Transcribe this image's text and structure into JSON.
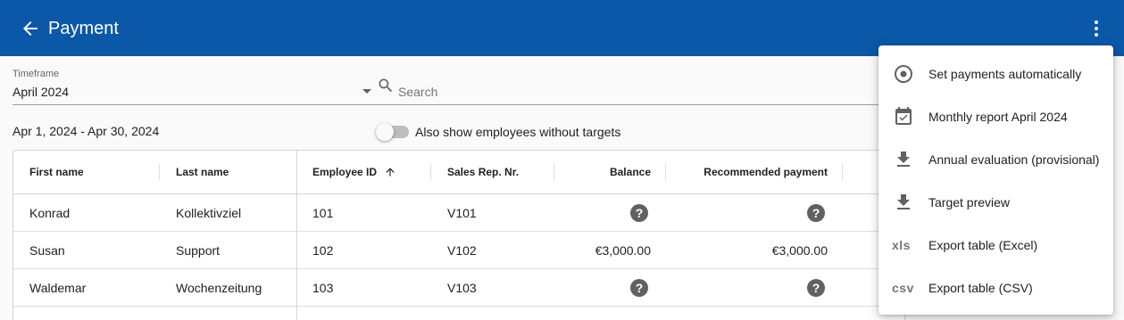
{
  "header": {
    "title": "Payment",
    "back_icon": "arrow-back-icon",
    "more_icon": "more-vert-icon",
    "bg_color": "#0b57a8"
  },
  "filters": {
    "timeframe_label": "Timeframe",
    "timeframe_value": "April 2024",
    "search_placeholder": "Search",
    "date_range": "Apr 1, 2024 - Apr 30, 2024",
    "toggle_label": "Also show employees without targets",
    "toggle_on": false
  },
  "table": {
    "columns": [
      "First name",
      "Last name",
      "Employee ID",
      "Sales Rep. Nr.",
      "Balance",
      "Recommended payment"
    ],
    "sorted_column": "Employee ID",
    "sort_direction": "ascending",
    "rows": [
      {
        "first": "Konrad",
        "last": "Kollektivziel",
        "id": "101",
        "rep": "V101",
        "balance": "?",
        "payment": "?"
      },
      {
        "first": "Susan",
        "last": "Support",
        "id": "102",
        "rep": "V102",
        "balance": "€3,000.00",
        "payment": "€3,000.00"
      },
      {
        "first": "Waldemar",
        "last": "Wochenzeitung",
        "id": "103",
        "rep": "V103",
        "balance": "?",
        "payment": "?"
      }
    ]
  },
  "menu": {
    "items": [
      {
        "label": "Set payments automatically",
        "icon": "radio-target-icon"
      },
      {
        "label": "Monthly report April 2024",
        "icon": "calendar-check-icon"
      },
      {
        "label": "Annual evaluation (provisional)",
        "icon": "download-icon"
      },
      {
        "label": "Target preview",
        "icon": "download-icon"
      },
      {
        "label": "Export table (Excel)",
        "icon": "xls-icon",
        "glyph": "xls"
      },
      {
        "label": "Export table (CSV)",
        "icon": "csv-icon",
        "glyph": "csv"
      }
    ]
  }
}
